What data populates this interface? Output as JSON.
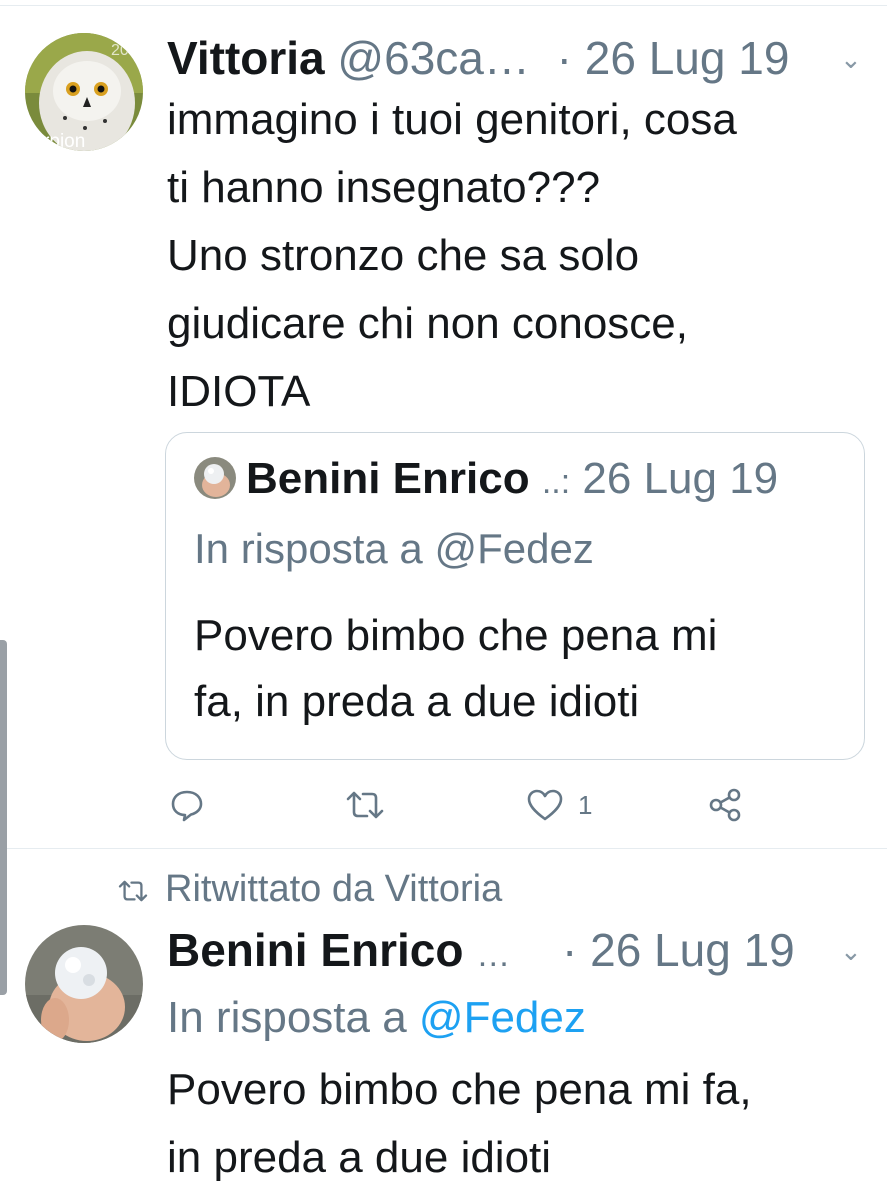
{
  "tweet1": {
    "author_name": "Vittoria",
    "handle": "@63ca…",
    "separator": "·",
    "date": "26 Lug 19",
    "avatar_caption": "corpion",
    "avatar_badge": "20",
    "text": "immagino i tuoi genitori, cosa\nti hanno insegnato???\nUno stronzo che sa solo\ngiudicare chi non conosce,\nIDIOTA",
    "quote": {
      "author_name": "Benini Enrico",
      "handle_trunc": "..:",
      "date": "26 Lug 19",
      "reply_to": "In risposta a @Fedez",
      "text": "Povero bimbo che pena mi\nfa, in preda a due idioti"
    },
    "actions": {
      "reply_icon": "comment-icon",
      "retweet_icon": "retweet-icon",
      "like_icon": "heart-icon",
      "like_count": "1",
      "share_icon": "share-icon"
    }
  },
  "tweet2": {
    "retweeted_by": "Ritwittato da Vittoria",
    "author_name": "Benini Enrico",
    "handle_trunc": "…",
    "separator": "·",
    "date": "26 Lug 19",
    "reply_prefix": "In risposta a",
    "reply_handle": "@Fedez",
    "text": "Povero bimbo che pena mi fa,\nin preda a due idioti"
  },
  "colors": {
    "text": "#14171a",
    "muted": "#657786",
    "link": "#1da1f2",
    "border": "#ccd6dd"
  }
}
